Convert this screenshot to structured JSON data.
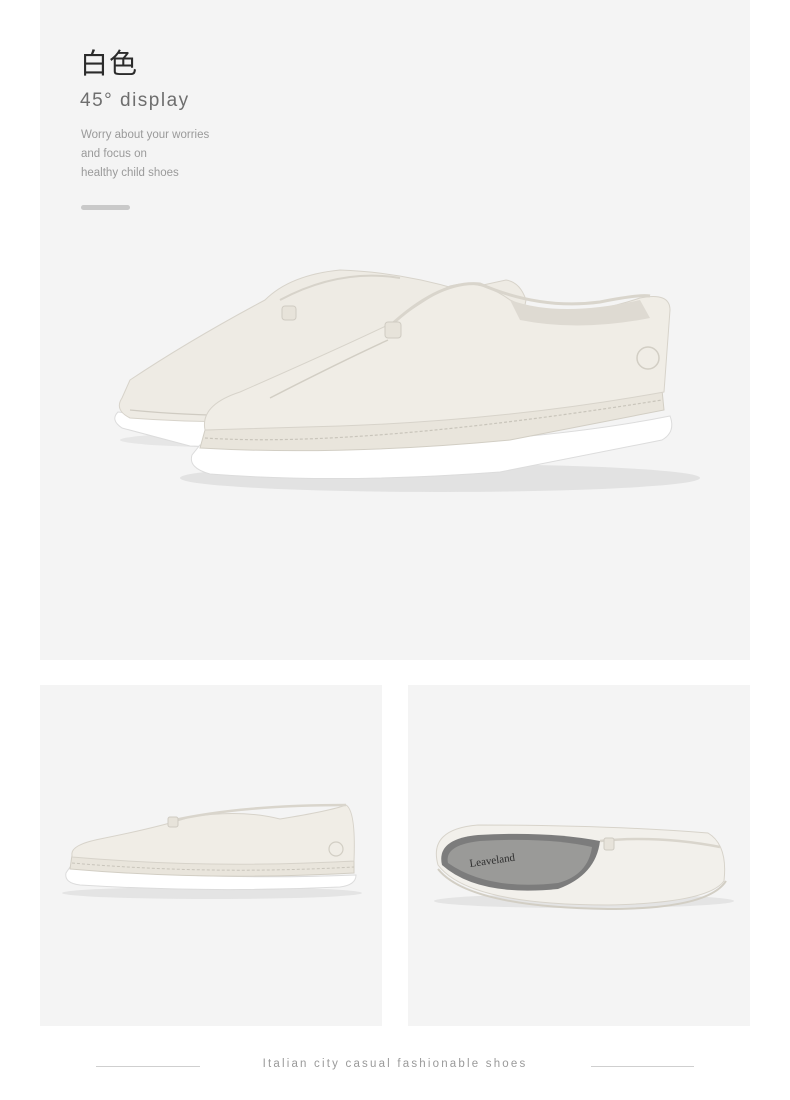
{
  "hero": {
    "title": "白色",
    "subtitle": "45° display",
    "description": [
      "Worry about your worries",
      "and focus on",
      "healthy child shoes"
    ]
  },
  "insole_logo": "Leaveland",
  "footer": {
    "tagline": "Italian city casual fashionable shoes"
  },
  "colors": {
    "panel_bg": "#f4f4f4",
    "shoe_leather": "#eeebe4",
    "sole": "#ffffff",
    "accent_bar": "#c9c9c9"
  }
}
